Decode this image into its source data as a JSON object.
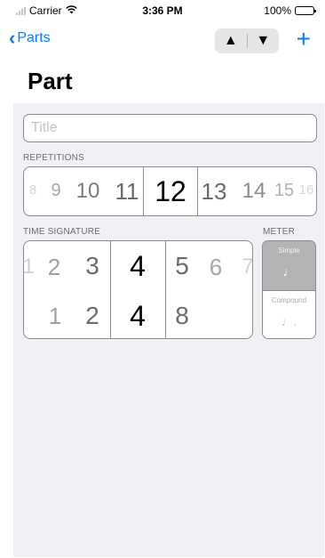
{
  "status": {
    "carrier": "Carrier",
    "time": "3:36 PM",
    "battery": "100%"
  },
  "nav": {
    "back_label": "Parts",
    "up_label": "▲",
    "down_label": "▼",
    "add_label": "+"
  },
  "page_title": "Part",
  "title_field": {
    "placeholder": "Title",
    "value": ""
  },
  "repetitions": {
    "label": "REPETITIONS",
    "selected": "12",
    "values": [
      "8",
      "9",
      "10",
      "11",
      "12",
      "13",
      "14",
      "15",
      "16"
    ]
  },
  "time_signature": {
    "label": "TIME SIGNATURE",
    "top_values": [
      "1",
      "2",
      "3",
      "4",
      "5",
      "6",
      "7"
    ],
    "bottom_values": [
      "1",
      "2",
      "4",
      "8"
    ],
    "top_selected": "4",
    "bottom_selected": "4"
  },
  "meter": {
    "label": "METER",
    "options": [
      {
        "label": "Simple",
        "note": "♩",
        "selected": true
      },
      {
        "label": "Compound",
        "note": "♩.",
        "selected": false
      }
    ]
  }
}
